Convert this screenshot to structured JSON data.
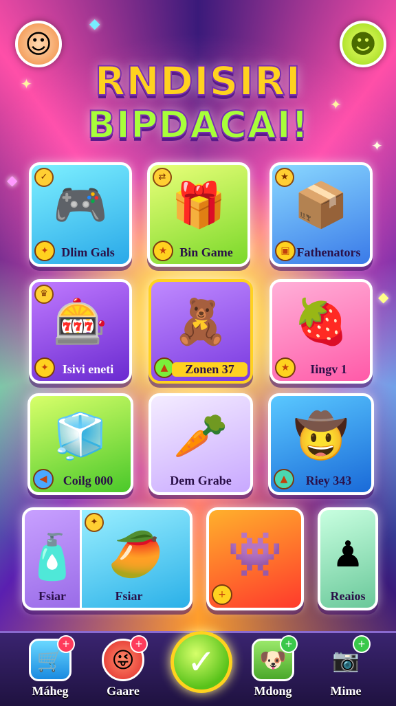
{
  "title": {
    "line1": "RNDISIRI",
    "line2": "BIPDACAI!"
  },
  "header": {
    "left_avatar": "boy-face-icon",
    "right_avatar": "smiley-face-icon"
  },
  "tiles": [
    {
      "label": "Dlim Gals",
      "icon": "gamepad-icon",
      "color": "#29c8ff"
    },
    {
      "label": "Bin Game",
      "icon": "gift-box-icon",
      "color": "#b8f03a"
    },
    {
      "label": "Fathenators",
      "icon": "gold-box-icon",
      "color": "#3aa8ff"
    },
    {
      "label": "Isivi eneti",
      "icon": "poker-chip-icon",
      "color": "#8a3ad8"
    },
    {
      "label": "Zonen 37",
      "icon": "treasure-icon",
      "color": "#8a3ad8"
    },
    {
      "label": "Iingv  1",
      "icon": "strawberry-icon",
      "color": "#ff6ab0"
    },
    {
      "label": "Coilg 000",
      "icon": "blue-cube-icon",
      "color": "#5ad83a"
    },
    {
      "label": "Dem Grabe",
      "icon": "carrot-icon",
      "color": "#e0c8ff"
    },
    {
      "label": "Riey 343",
      "icon": "character-icon",
      "color": "#1f9ae0"
    },
    {
      "label": "Fsiar",
      "icon": "bottle-icon",
      "color": "#9a6ae8"
    },
    {
      "label": "Fsiar",
      "icon": "mango-sword-icon",
      "color": "#3ac8ff"
    },
    {
      "label": "",
      "icon": "monster-icon",
      "color": "#ff6a2c"
    },
    {
      "label": "Reaios",
      "icon": "blue-figure-icon",
      "color": "#6ad8b0"
    }
  ],
  "nav": [
    {
      "label": "Máheg",
      "icon": "shop-icon"
    },
    {
      "label": "Gaare",
      "icon": "mascot-icon"
    },
    {
      "label": "",
      "icon": "check-icon"
    },
    {
      "label": "Mdong",
      "icon": "dog-icon"
    },
    {
      "label": "Mime",
      "icon": "camera-icon"
    }
  ]
}
